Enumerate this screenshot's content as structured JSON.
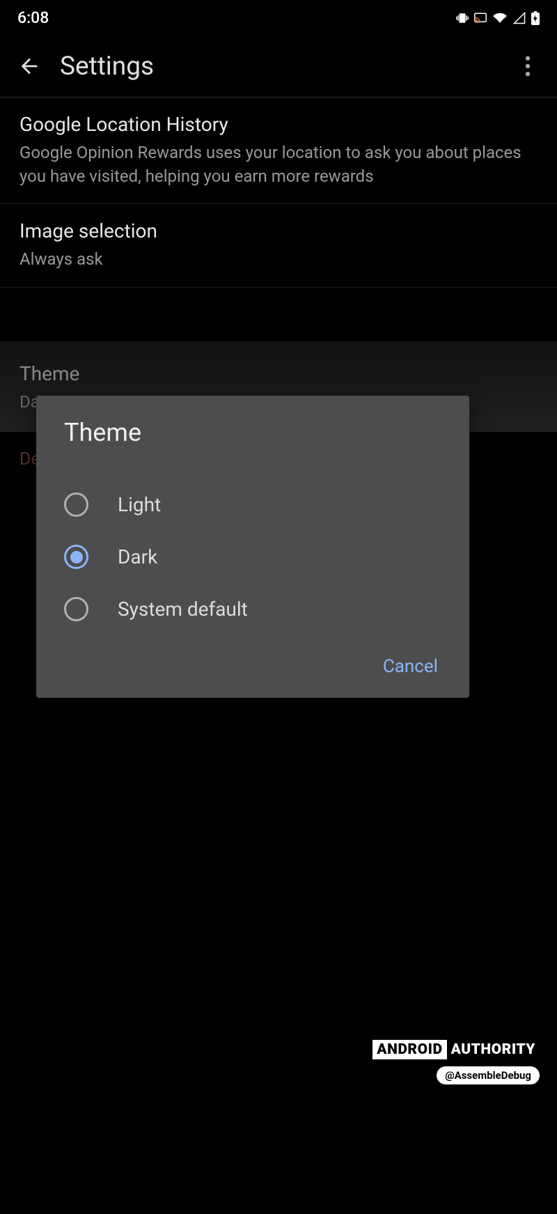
{
  "status": {
    "time": "6:08"
  },
  "header": {
    "title": "Settings"
  },
  "settings": {
    "location_history": {
      "title": "Google Location History",
      "subtitle": "Google Opinion Rewards uses your location to ask you about places you have visited, helping you earn more rewards"
    },
    "image_selection": {
      "title": "Image selection",
      "subtitle": "Always ask"
    },
    "theme": {
      "title": "Theme",
      "subtitle": "Da"
    },
    "delete": {
      "title": "Delete Opinion Rewards account"
    }
  },
  "dialog": {
    "title": "Theme",
    "options": [
      {
        "label": "Light",
        "selected": false
      },
      {
        "label": "Dark",
        "selected": true
      },
      {
        "label": "System default",
        "selected": false
      }
    ],
    "cancel": "Cancel"
  },
  "watermark": {
    "brand_left": "ANDROID",
    "brand_right": "AUTHORITY",
    "handle": "@AssembleDebug"
  }
}
